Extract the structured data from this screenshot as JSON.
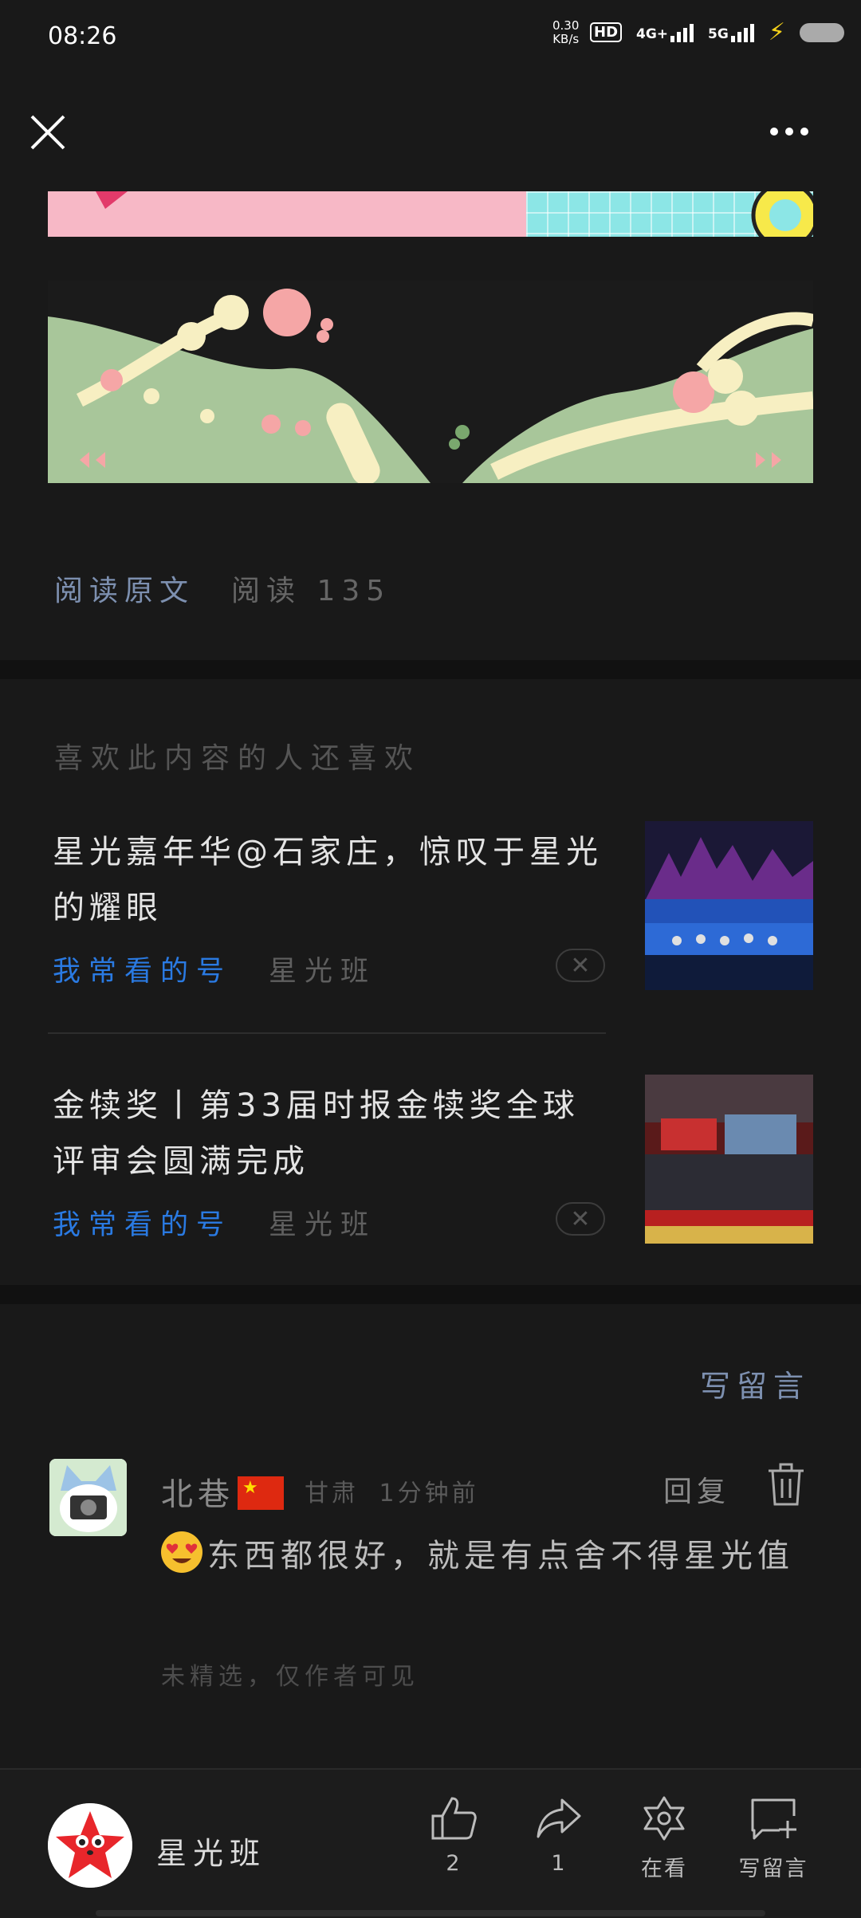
{
  "status_bar": {
    "time": "08:26",
    "net_speed_value": "0.30",
    "net_speed_unit": "KB/s",
    "hd_label": "HD",
    "lte_label": "4G+",
    "nr_label": "5G"
  },
  "article_footer": {
    "read_original": "阅读原文",
    "read_count": "阅读 135"
  },
  "recommend": {
    "heading": "喜欢此内容的人还喜欢",
    "items": [
      {
        "title": "星光嘉年华@石家庄，惊叹于星光的耀眼",
        "tag": "我常看的号",
        "source": "星光班"
      },
      {
        "title": "金犊奖丨第33届时报金犊奖全球评审会圆满完成",
        "tag": "我常看的号",
        "source": "星光班"
      }
    ]
  },
  "comments": {
    "write_label": "写留言",
    "items": [
      {
        "author": "北巷",
        "region": "甘肃",
        "time": "1分钟前",
        "reply_label": "回复",
        "text": "东西都很好，就是有点舍不得星光值",
        "note": "未精选，仅作者可见"
      }
    ]
  },
  "bottom_bar": {
    "account_name": "星光班",
    "like_count": "2",
    "share_count": "1",
    "wow_label": "在看",
    "comment_label": "写留言"
  },
  "colors": {
    "background": "#191919",
    "link_blue": "#2a7ae2",
    "link_gray_blue": "#7d90b0"
  }
}
